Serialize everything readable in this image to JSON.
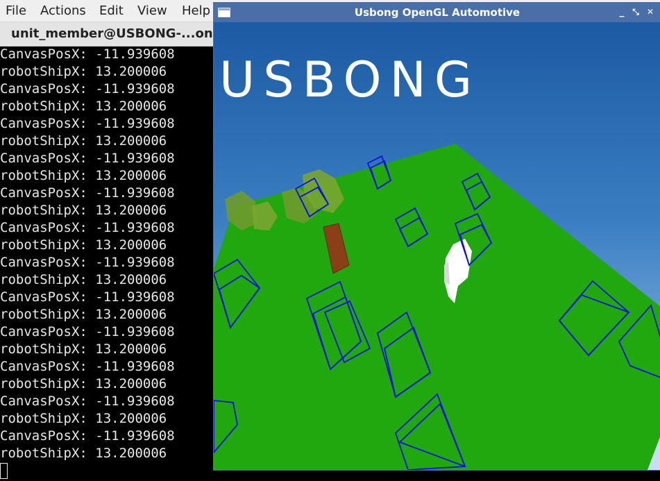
{
  "terminal": {
    "menu": [
      "File",
      "Actions",
      "Edit",
      "View",
      "Help"
    ],
    "tab_title": "unit_member@USBONG-...ongA",
    "lines": [
      "CanvasPosX: -11.939608",
      "robotShipX: 13.200006",
      "CanvasPosX: -11.939608",
      "robotShipX: 13.200006",
      "CanvasPosX: -11.939608",
      "robotShipX: 13.200006",
      "CanvasPosX: -11.939608",
      "robotShipX: 13.200006",
      "CanvasPosX: -11.939608",
      "robotShipX: 13.200006",
      "CanvasPosX: -11.939608",
      "robotShipX: 13.200006",
      "CanvasPosX: -11.939608",
      "robotShipX: 13.200006",
      "CanvasPosX: -11.939608",
      "robotShipX: 13.200006",
      "CanvasPosX: -11.939608",
      "robotShipX: 13.200006",
      "CanvasPosX: -11.939608",
      "robotShipX: 13.200006",
      "CanvasPosX: -11.939608",
      "robotShipX: 13.200006",
      "CanvasPosX: -11.939608",
      "robotShipX: 13.200006"
    ]
  },
  "gl_window": {
    "title": "Usbong OpenGL Automotive",
    "controls": {
      "minimize": "_",
      "restore": "⤡",
      "close": "✕"
    },
    "canvas_text": "USBONG",
    "colors": {
      "sky_top": "#1c5aa3",
      "sky_bottom": "#7fb0de",
      "ground": "#22a80f",
      "wireframe": "#1010e0",
      "tree_leaves": "#6f9a2d",
      "tree_trunk": "#8a3f16",
      "robot": "#ffffff"
    }
  }
}
